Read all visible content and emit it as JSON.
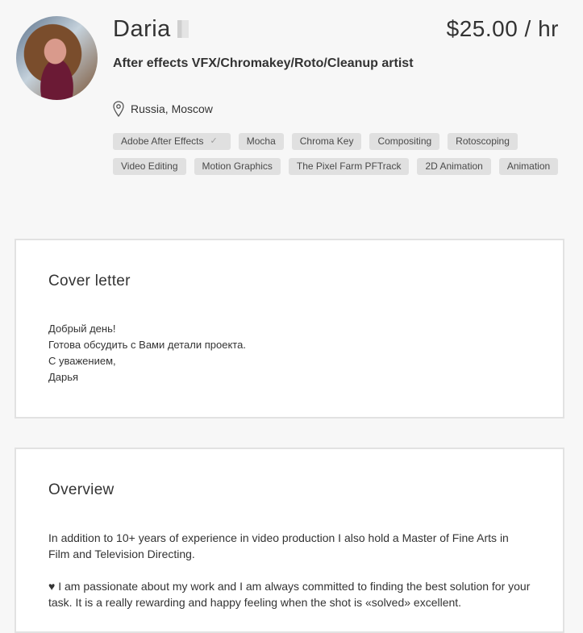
{
  "profile": {
    "name": "Daria",
    "rate": "$25.00 / hr",
    "title": "After effects VFX/Chromakey/Roto/Cleanup artist",
    "location": "Russia, Moscow",
    "skills": [
      {
        "label": "Adobe After Effects",
        "verified": true
      },
      {
        "label": "Mocha"
      },
      {
        "label": "Chroma Key"
      },
      {
        "label": "Compositing"
      },
      {
        "label": "Rotoscoping"
      },
      {
        "label": "Video Editing"
      },
      {
        "label": "Motion Graphics"
      },
      {
        "label": "The Pixel Farm PFTrack"
      },
      {
        "label": "2D Animation"
      },
      {
        "label": "Animation"
      }
    ],
    "check_icon": "✓"
  },
  "cover_letter": {
    "heading": "Cover letter",
    "lines": [
      "Добрый день!",
      "Готова обсудить с Вами детали проекта.",
      "С уважением,",
      "Дарья"
    ]
  },
  "overview": {
    "heading": "Overview",
    "paragraphs": [
      "In addition to 10+ years of experience in video production I also hold a Master of Fine Arts in Film and Television Directing.",
      "♥ I am passionate about my work and I am always committed to finding the best solution for your task. It is a really rewarding and happy feeling when the shot is «solved» excellent."
    ]
  }
}
